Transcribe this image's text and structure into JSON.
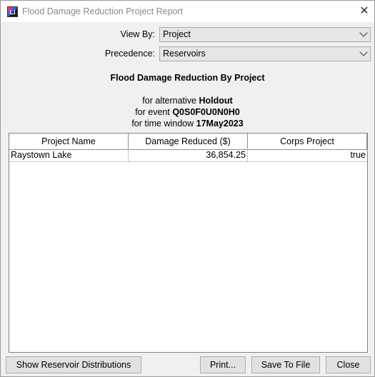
{
  "window": {
    "title": "Flood Damage Reduction Project Report"
  },
  "controls": {
    "view_by_label": "View By:",
    "view_by_value": "Project",
    "precedence_label": "Precedence:",
    "precedence_value": "Reservoirs"
  },
  "report": {
    "title": "Flood Damage Reduction By Project",
    "alternative_prefix": "for alternative ",
    "alternative": "Holdout",
    "event_prefix": "for event ",
    "event": "Q0S0F0U0N0H0",
    "time_window_prefix": "for time window ",
    "time_window": "17May2023"
  },
  "table": {
    "columns": [
      "Project Name",
      "Damage Reduced ($)",
      "Corps Project"
    ],
    "rows": [
      [
        "Raystown Lake",
        "36,854.25",
        "true"
      ]
    ]
  },
  "buttons": {
    "show_distributions": "Show Reservoir Distributions",
    "print": "Print...",
    "save": "Save To File",
    "close": "Close"
  },
  "icons": {
    "app": "app-icon",
    "close": "close-icon"
  }
}
